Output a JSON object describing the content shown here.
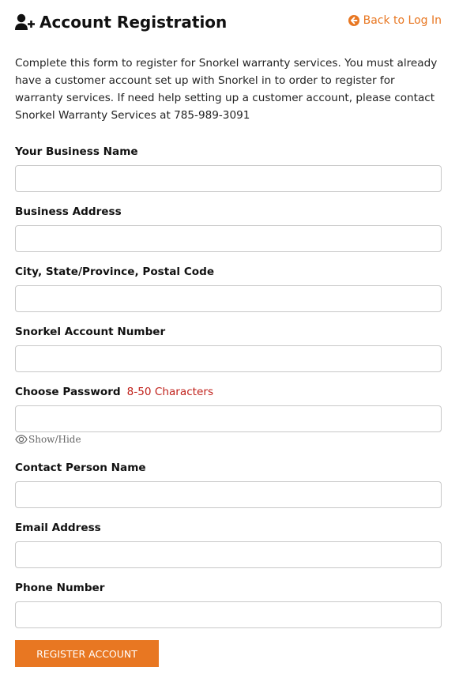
{
  "header": {
    "title": "Account Registration",
    "back_link": "Back to Log In"
  },
  "intro": "Complete this form to register for Snorkel warranty services. You must already have a customer account set up with Snorkel in to order to register for warranty services. If need help setting up a customer account, please contact Snorkel Warranty Services at 785-989-3091",
  "fields": [
    {
      "label": "Your Business Name",
      "value": "",
      "type": "text"
    },
    {
      "label": "Business Address",
      "value": "",
      "type": "text"
    },
    {
      "label": "City, State/Province, Postal Code",
      "value": "",
      "type": "text"
    },
    {
      "label": "Snorkel Account Number",
      "value": "",
      "type": "text"
    },
    {
      "label": "Choose Password",
      "hint": "8-50 Characters",
      "value": "",
      "type": "password",
      "toggle_label": "Show/Hide"
    },
    {
      "label": "Contact Person Name",
      "value": "",
      "type": "text"
    },
    {
      "label": "Email Address",
      "value": "",
      "type": "email"
    },
    {
      "label": "Phone Number",
      "value": "",
      "type": "tel"
    }
  ],
  "submit_label": "REGISTER ACCOUNT",
  "colors": {
    "accent": "#e87722",
    "hint": "#c0201a",
    "border": "#c8c8c8"
  },
  "icons": [
    "user-plus-icon",
    "arrow-left-circle-icon",
    "eye-icon"
  ]
}
